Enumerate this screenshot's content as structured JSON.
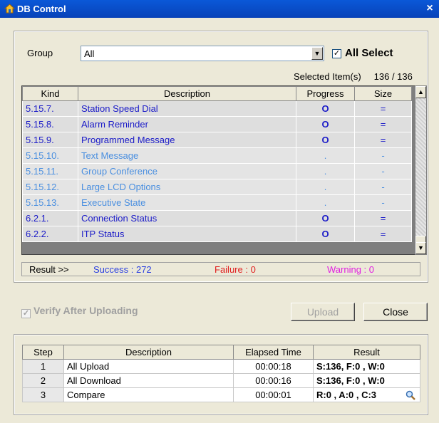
{
  "window": {
    "title": "DB Control",
    "close_glyph": "×"
  },
  "filter": {
    "group_label": "Group",
    "group_value": "All",
    "all_select_label": "All Select",
    "all_select_checked": true,
    "selected_label": "Selected Item(s)",
    "selected_count": "136 / 136"
  },
  "grid": {
    "headers": {
      "kind": "Kind",
      "description": "Description",
      "progress": "Progress",
      "size": "Size"
    },
    "rows": [
      {
        "kind": "5.15.7.",
        "description": "Station Speed Dial",
        "progress": "O",
        "size": "="
      },
      {
        "kind": "5.15.8.",
        "description": "Alarm Reminder",
        "progress": "O",
        "size": "="
      },
      {
        "kind": "5.15.9.",
        "description": "Programmed Message",
        "progress": "O",
        "size": "="
      },
      {
        "kind": "5.15.10.",
        "description": "Text Message",
        "progress": ".",
        "size": "-"
      },
      {
        "kind": "5.15.11.",
        "description": "Group Conference",
        "progress": ".",
        "size": "-"
      },
      {
        "kind": "5.15.12.",
        "description": "Large LCD Options",
        "progress": ".",
        "size": "-"
      },
      {
        "kind": "5.15.13.",
        "description": "Executive State",
        "progress": ".",
        "size": "-"
      },
      {
        "kind": "6.2.1.",
        "description": "Connection Status",
        "progress": "O",
        "size": "="
      },
      {
        "kind": "6.2.2.",
        "description": "ITP Status",
        "progress": "O",
        "size": "="
      }
    ]
  },
  "result": {
    "label": "Result >>",
    "success": "Success : 272",
    "failure": "Failure : 0",
    "warning": "Warning : 0",
    "colors": {
      "success": "#2a3fe0",
      "failure": "#e02020",
      "warning": "#e020e0"
    }
  },
  "verify": {
    "label": "Verify After Uploading",
    "checked": true,
    "enabled": false
  },
  "buttons": {
    "upload": "Upload",
    "close": "Close"
  },
  "steps": {
    "headers": {
      "step": "Step",
      "description": "Description",
      "elapsed": "Elapsed Time",
      "result": "Result"
    },
    "rows": [
      {
        "step": "1",
        "description": "All Upload",
        "elapsed": "00:00:18",
        "result": "S:136, F:0 , W:0"
      },
      {
        "step": "2",
        "description": "All Download",
        "elapsed": "00:00:16",
        "result": "S:136, F:0 , W:0"
      },
      {
        "step": "3",
        "description": "Compare",
        "elapsed": "00:00:01",
        "result": "R:0 , A:0 , C:3"
      }
    ]
  },
  "icons": {
    "title": "app-icon",
    "detail": "magnifier-icon",
    "scroll_up": "arrow-up-icon",
    "scroll_down": "arrow-down-icon",
    "combo": "arrow-down-icon"
  }
}
